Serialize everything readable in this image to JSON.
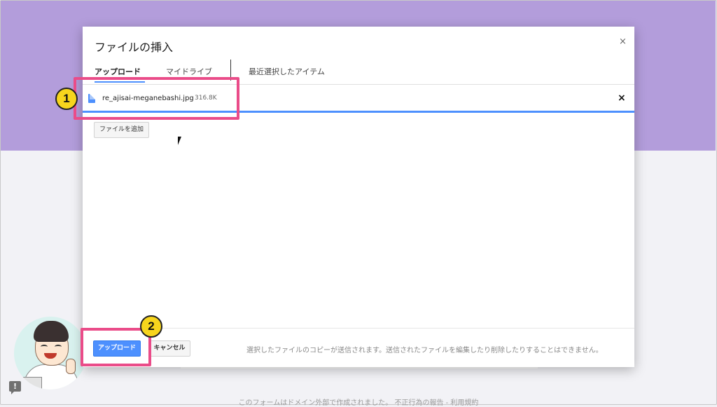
{
  "dialog": {
    "title": "ファイルの挿入",
    "close_label": "×",
    "tabs": [
      {
        "label": "アップロード",
        "active": true
      },
      {
        "label": "マイドライブ",
        "active": false
      },
      {
        "label": "最近選択したアイテム",
        "active": false
      }
    ],
    "file": {
      "name": "re_ajisai-meganebashi.jpg",
      "size": "316.8K",
      "remove_label": "×",
      "icon": "file-icon"
    },
    "add_file_label": "ファイルを追加",
    "upload_label": "アップロード",
    "cancel_label": "キャンセル",
    "note": "選択したファイルのコピーが送信されます。送信されたファイルを編集したり削除したりすることはできません。"
  },
  "annotations": {
    "badge_1": "1",
    "badge_2": "2"
  },
  "page": {
    "footer_text": "このフォームはドメイン外部で作成されました。 不正行為の報告 - 利用規約",
    "feedback_icon_label": "!"
  },
  "colors": {
    "header_band": "#b39ddb",
    "accent_blue": "#4d90fe",
    "highlight_pink": "#ea4c89",
    "badge_yellow": "#f7d51d"
  }
}
